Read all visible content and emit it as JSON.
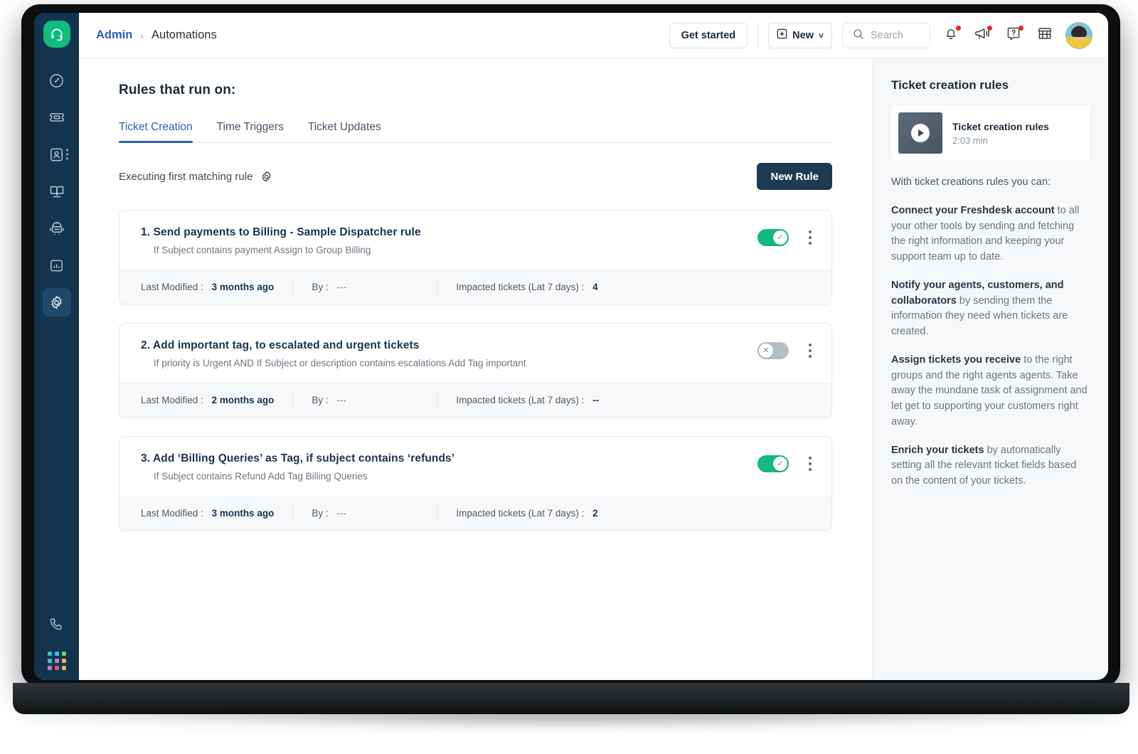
{
  "rail": {
    "logo_icon": "headset-logo-icon",
    "items": [
      {
        "icon": "dashboard-gauge-icon",
        "name": "dashboard",
        "active": false
      },
      {
        "icon": "ticket-icon",
        "name": "tickets",
        "active": false
      },
      {
        "icon": "contacts-icon",
        "name": "contacts",
        "active": false
      },
      {
        "icon": "knowledge-base-book-icon",
        "name": "solutions",
        "active": false
      },
      {
        "icon": "bot-icon",
        "name": "bots",
        "active": false
      },
      {
        "icon": "analytics-bar-chart-icon",
        "name": "analytics",
        "active": false
      },
      {
        "icon": "gear-icon",
        "name": "admin",
        "active": true
      }
    ],
    "phone_icon": "phone-icon",
    "grid_icon": "app-switcher-grid-icon",
    "grid_colors": [
      "#36c5d1",
      "#36c5d1",
      "#7fc96b",
      "#36c5d1",
      "#b77fd0",
      "#e8b54a",
      "#b77fd0",
      "#e05a5a",
      "#e8b54a"
    ]
  },
  "header": {
    "breadcrumb_root": "Admin",
    "breadcrumb_sep": "›",
    "breadcrumb_current": "Automations",
    "get_started_label": "Get started",
    "new_label": "New",
    "new_caret": "˅",
    "search_placeholder": "Search",
    "icons": {
      "search": "search-icon",
      "notifications": "bell-icon",
      "announcements": "megaphone-icon",
      "help": "help-question-icon",
      "marketplace": "marketplace-store-icon",
      "avatar": "user-avatar"
    }
  },
  "content": {
    "page_title": "Rules that run on:",
    "tabs": [
      {
        "label": "Ticket Creation",
        "active": true
      },
      {
        "label": "Time Triggers",
        "active": false
      },
      {
        "label": "Ticket Updates",
        "active": false
      }
    ],
    "execution_mode_label": "Executing first matching rule",
    "execution_settings_icon": "gear-icon",
    "new_rule_label": "New Rule",
    "foot_labels": {
      "last_modified": "Last Modified :",
      "by": "By :",
      "impacted": "Impacted tickets (Lat 7 days) :"
    },
    "rules": [
      {
        "index": "1.",
        "title": "Send payments to Billing - Sample Dispatcher rule",
        "description": "If Subject contains payment Assign to Group Billing",
        "enabled": true,
        "toggle_glyph": "✓",
        "last_modified": "3 months ago",
        "by": "---",
        "impacted": "4"
      },
      {
        "index": "2.",
        "title": "Add important tag, to escalated and urgent tickets",
        "description": "If priority is Urgent AND If Subject or description contains escalations Add Tag important",
        "enabled": false,
        "toggle_glyph": "✕",
        "last_modified": "2 months ago",
        "by": "---",
        "impacted": "--"
      },
      {
        "index": "3.",
        "title": "Add ‘Billing Queries’ as Tag, if subject contains ‘refunds’",
        "description": "If Subject contains Refund Add Tag Billing Queries",
        "enabled": true,
        "toggle_glyph": "✓",
        "last_modified": "3 months ago",
        "by": "---",
        "impacted": "2"
      }
    ]
  },
  "right_panel": {
    "title": "Ticket creation rules",
    "video": {
      "title": "Ticket creation rules",
      "duration": "2:03 min",
      "play_icon": "play-icon"
    },
    "lead": "With ticket creations rules you can:",
    "paragraphs": [
      {
        "bold": "Connect your Freshdesk account",
        "rest": " to all your other tools by sending and fetching the right information and keeping your support team up to date."
      },
      {
        "bold": "Notify your agents, customers, and collaborators",
        "rest": " by sending them the information they need when tickets are created."
      },
      {
        "bold": "Assign tickets you receive",
        "rest": " to the right groups and the right agents agents. Take away the mundane task of assignment and let get to supporting your customers right away."
      },
      {
        "bold": "Enrich your tickets",
        "rest": " by automatically setting all the relevant ticket fields based on the content of your tickets."
      }
    ]
  },
  "colors": {
    "rail_bg": "#12344d",
    "logo_green": "#0fbd7e",
    "accent_blue": "#2c5cc5",
    "toggle_on": "#12b886",
    "toggle_off": "#b6bec7",
    "new_rule_bg": "#1e3a52",
    "badge_red": "#f5222d"
  }
}
